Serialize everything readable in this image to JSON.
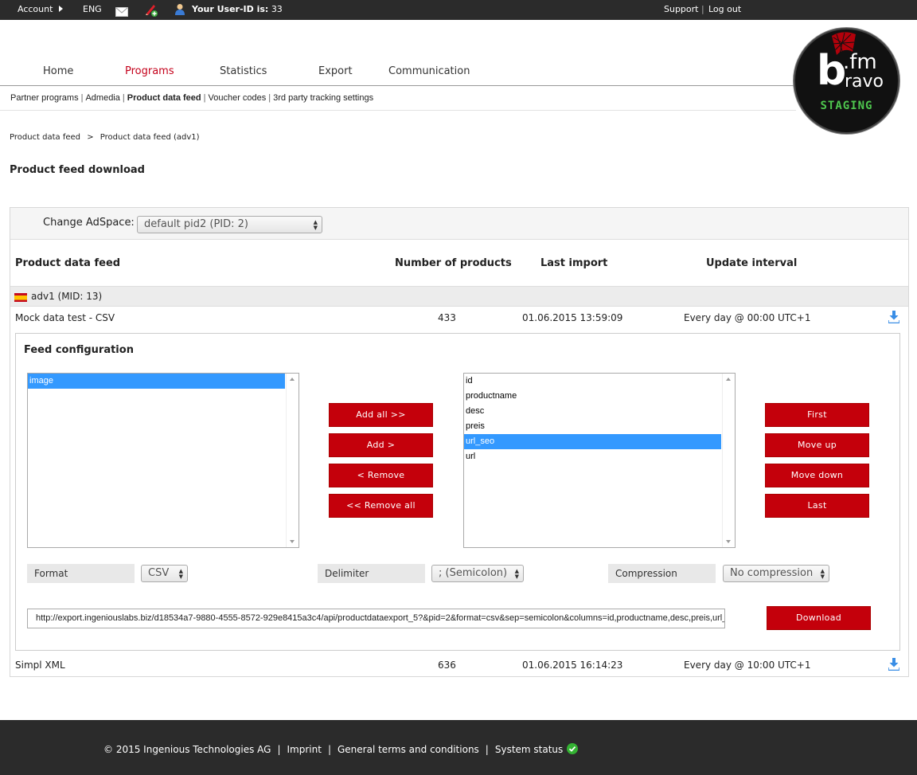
{
  "topbar": {
    "account": "Account",
    "lang": "ENG",
    "user_id_label": "Your User-ID is:",
    "user_id": "33",
    "support": "Support",
    "separator": "|",
    "logout": "Log out"
  },
  "nav": {
    "items": [
      "Home",
      "Programs",
      "Statistics",
      "Export",
      "Communication"
    ],
    "active": "Programs"
  },
  "subnav": {
    "items": [
      "Partner programs",
      "Admedia",
      "Product data feed",
      "Voucher codes",
      "3rd party tracking settings"
    ],
    "active": "Product data feed"
  },
  "logo": {
    "main": "b",
    "fm": ".fm",
    "ravo": "ravo",
    "env": "STAGING"
  },
  "breadcrumb": {
    "root": "Product data feed",
    "sep": ">",
    "current": "Product data feed (adv1)"
  },
  "page_title": "Product feed download",
  "adspace": {
    "label": "Change AdSpace:",
    "value": "default pid2 (PID: 2)"
  },
  "table": {
    "headers": [
      "Product data feed",
      "Number of products",
      "Last import",
      "Update interval"
    ],
    "group": "adv1 (MID: 13)",
    "rows": [
      {
        "name": "Mock data test - CSV",
        "count": "433",
        "last_import": "01.06.2015 13:59:09",
        "interval": "Every day @ 00:00 UTC+1"
      },
      {
        "name": "Simpl XML",
        "count": "636",
        "last_import": "01.06.2015 16:14:23",
        "interval": "Every day @ 10:00 UTC+1"
      }
    ]
  },
  "feed_config": {
    "title": "Feed configuration",
    "available": [
      "image"
    ],
    "available_selected": "image",
    "selected": [
      "id",
      "productname",
      "desc",
      "preis",
      "url_seo",
      "url"
    ],
    "selected_selected": "url_seo",
    "buttons": {
      "add_all": "Add all >>",
      "add": "Add >",
      "remove": "< Remove",
      "remove_all": "<< Remove all"
    },
    "order_buttons": {
      "first": "First",
      "move_up": "Move up",
      "move_down": "Move down",
      "last": "Last"
    },
    "format": {
      "label": "Format",
      "value": "CSV"
    },
    "delimiter": {
      "label": "Delimiter",
      "value": "; (Semicolon)"
    },
    "compression": {
      "label": "Compression",
      "value": "No compression"
    },
    "url": "http://export.ingeniouslabs.biz/d18534a7-9880-4555-8572-929e8415a3c4/api/productdataexport_5?&pid=2&format=csv&sep=semicolon&columns=id,productname,desc,preis,url_seo,url",
    "download": "Download"
  },
  "footer": {
    "copyright": "© 2015 Ingenious Technologies AG",
    "imprint": "Imprint",
    "terms": "General terms and conditions",
    "status": "System status",
    "separator": "|"
  },
  "colors": {
    "accent": "#c4000b",
    "dark": "#2b2b2b",
    "status_ok": "#34b233",
    "selection": "#3399ff"
  }
}
